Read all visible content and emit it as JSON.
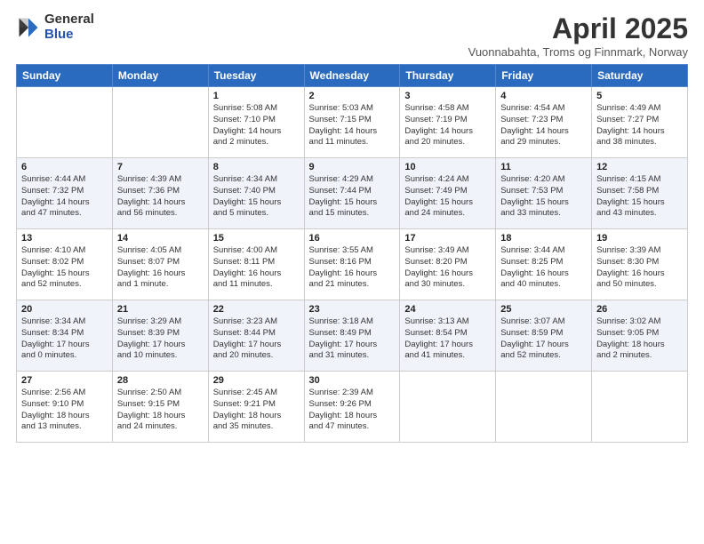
{
  "logo": {
    "general": "General",
    "blue": "Blue"
  },
  "header": {
    "title": "April 2025",
    "subtitle": "Vuonnabahta, Troms og Finnmark, Norway"
  },
  "weekdays": [
    "Sunday",
    "Monday",
    "Tuesday",
    "Wednesday",
    "Thursday",
    "Friday",
    "Saturday"
  ],
  "weeks": [
    [
      {
        "day": "",
        "info": ""
      },
      {
        "day": "",
        "info": ""
      },
      {
        "day": "1",
        "info": "Sunrise: 5:08 AM\nSunset: 7:10 PM\nDaylight: 14 hours\nand 2 minutes."
      },
      {
        "day": "2",
        "info": "Sunrise: 5:03 AM\nSunset: 7:15 PM\nDaylight: 14 hours\nand 11 minutes."
      },
      {
        "day": "3",
        "info": "Sunrise: 4:58 AM\nSunset: 7:19 PM\nDaylight: 14 hours\nand 20 minutes."
      },
      {
        "day": "4",
        "info": "Sunrise: 4:54 AM\nSunset: 7:23 PM\nDaylight: 14 hours\nand 29 minutes."
      },
      {
        "day": "5",
        "info": "Sunrise: 4:49 AM\nSunset: 7:27 PM\nDaylight: 14 hours\nand 38 minutes."
      }
    ],
    [
      {
        "day": "6",
        "info": "Sunrise: 4:44 AM\nSunset: 7:32 PM\nDaylight: 14 hours\nand 47 minutes."
      },
      {
        "day": "7",
        "info": "Sunrise: 4:39 AM\nSunset: 7:36 PM\nDaylight: 14 hours\nand 56 minutes."
      },
      {
        "day": "8",
        "info": "Sunrise: 4:34 AM\nSunset: 7:40 PM\nDaylight: 15 hours\nand 5 minutes."
      },
      {
        "day": "9",
        "info": "Sunrise: 4:29 AM\nSunset: 7:44 PM\nDaylight: 15 hours\nand 15 minutes."
      },
      {
        "day": "10",
        "info": "Sunrise: 4:24 AM\nSunset: 7:49 PM\nDaylight: 15 hours\nand 24 minutes."
      },
      {
        "day": "11",
        "info": "Sunrise: 4:20 AM\nSunset: 7:53 PM\nDaylight: 15 hours\nand 33 minutes."
      },
      {
        "day": "12",
        "info": "Sunrise: 4:15 AM\nSunset: 7:58 PM\nDaylight: 15 hours\nand 43 minutes."
      }
    ],
    [
      {
        "day": "13",
        "info": "Sunrise: 4:10 AM\nSunset: 8:02 PM\nDaylight: 15 hours\nand 52 minutes."
      },
      {
        "day": "14",
        "info": "Sunrise: 4:05 AM\nSunset: 8:07 PM\nDaylight: 16 hours\nand 1 minute."
      },
      {
        "day": "15",
        "info": "Sunrise: 4:00 AM\nSunset: 8:11 PM\nDaylight: 16 hours\nand 11 minutes."
      },
      {
        "day": "16",
        "info": "Sunrise: 3:55 AM\nSunset: 8:16 PM\nDaylight: 16 hours\nand 21 minutes."
      },
      {
        "day": "17",
        "info": "Sunrise: 3:49 AM\nSunset: 8:20 PM\nDaylight: 16 hours\nand 30 minutes."
      },
      {
        "day": "18",
        "info": "Sunrise: 3:44 AM\nSunset: 8:25 PM\nDaylight: 16 hours\nand 40 minutes."
      },
      {
        "day": "19",
        "info": "Sunrise: 3:39 AM\nSunset: 8:30 PM\nDaylight: 16 hours\nand 50 minutes."
      }
    ],
    [
      {
        "day": "20",
        "info": "Sunrise: 3:34 AM\nSunset: 8:34 PM\nDaylight: 17 hours\nand 0 minutes."
      },
      {
        "day": "21",
        "info": "Sunrise: 3:29 AM\nSunset: 8:39 PM\nDaylight: 17 hours\nand 10 minutes."
      },
      {
        "day": "22",
        "info": "Sunrise: 3:23 AM\nSunset: 8:44 PM\nDaylight: 17 hours\nand 20 minutes."
      },
      {
        "day": "23",
        "info": "Sunrise: 3:18 AM\nSunset: 8:49 PM\nDaylight: 17 hours\nand 31 minutes."
      },
      {
        "day": "24",
        "info": "Sunrise: 3:13 AM\nSunset: 8:54 PM\nDaylight: 17 hours\nand 41 minutes."
      },
      {
        "day": "25",
        "info": "Sunrise: 3:07 AM\nSunset: 8:59 PM\nDaylight: 17 hours\nand 52 minutes."
      },
      {
        "day": "26",
        "info": "Sunrise: 3:02 AM\nSunset: 9:05 PM\nDaylight: 18 hours\nand 2 minutes."
      }
    ],
    [
      {
        "day": "27",
        "info": "Sunrise: 2:56 AM\nSunset: 9:10 PM\nDaylight: 18 hours\nand 13 minutes."
      },
      {
        "day": "28",
        "info": "Sunrise: 2:50 AM\nSunset: 9:15 PM\nDaylight: 18 hours\nand 24 minutes."
      },
      {
        "day": "29",
        "info": "Sunrise: 2:45 AM\nSunset: 9:21 PM\nDaylight: 18 hours\nand 35 minutes."
      },
      {
        "day": "30",
        "info": "Sunrise: 2:39 AM\nSunset: 9:26 PM\nDaylight: 18 hours\nand 47 minutes."
      },
      {
        "day": "",
        "info": ""
      },
      {
        "day": "",
        "info": ""
      },
      {
        "day": "",
        "info": ""
      }
    ]
  ]
}
